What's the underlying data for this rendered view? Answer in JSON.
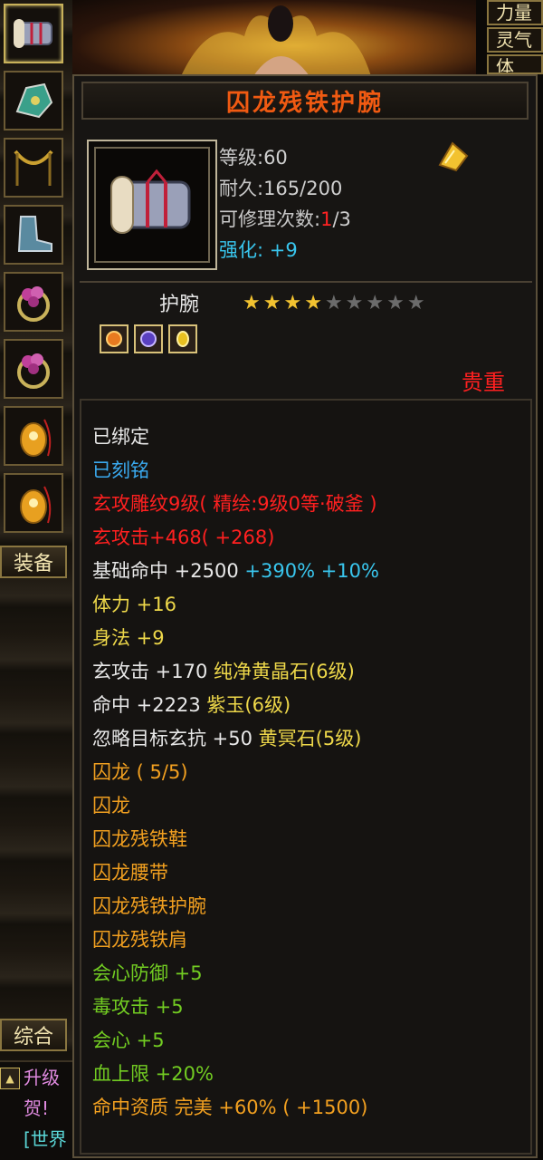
{
  "left_panel": {
    "tab_equipment": "装备",
    "tab_general": "综合",
    "chat_lines": [
      "升级",
      "贺!",
      "[世界"
    ],
    "chat_colors": [
      "#e08ae0",
      "#e08ae0",
      "#5ad6d6"
    ],
    "slots": [
      "bracer",
      "gauntlet",
      "necklace",
      "boots",
      "ring",
      "ring",
      "pendant",
      "pendant"
    ]
  },
  "right_buttons": [
    "力量",
    "灵气",
    "体"
  ],
  "tooltip": {
    "title": "囚龙残铁护腕",
    "level_label": "等级",
    "level_value": ":60",
    "durability_label": "耐久",
    "durability_value": ":165/200",
    "repair_label": "可修理次数",
    "repair_used": "1",
    "repair_total": "/3",
    "enhance_label": "强化",
    "enhance_value": ": +9",
    "item_type": "护腕",
    "stars": {
      "filled": 4,
      "total": 9
    },
    "quality": "贵重",
    "colors": {
      "title": "#f05a12",
      "cyan": "#39c6ee",
      "red": "#ff2020"
    }
  },
  "attributes": [
    {
      "text": "已绑定",
      "color": "white"
    },
    {
      "text": "已刻铭",
      "color": "blue"
    },
    {
      "text": "玄攻雕纹9级( 精绘:9级0等·破釜 )",
      "color": "red"
    },
    {
      "text": "玄攻击+468( +268)",
      "color": "red"
    },
    {
      "text": "基础命中 +2500 ",
      "color": "white",
      "extra": "+390% +10%",
      "extra_color": "cyan"
    },
    {
      "text": "体力 +16",
      "color": "yellow"
    },
    {
      "text": "身法 +9",
      "color": "yellow"
    },
    {
      "text": "玄攻击 +170 ",
      "color": "white",
      "extra": "纯净黄晶石(6级)",
      "extra_color": "yellow"
    },
    {
      "text": "命中 +2223 ",
      "color": "white",
      "extra": "紫玉(6级)",
      "extra_color": "yellow"
    },
    {
      "text": "忽略目标玄抗 +50 ",
      "color": "white",
      "extra": "黄冥石(5级)",
      "extra_color": "yellow"
    },
    {
      "text": "囚龙 ( 5/5)",
      "color": "orange"
    },
    {
      "text": "囚龙",
      "color": "orange"
    },
    {
      "text": "囚龙残铁鞋",
      "color": "orange"
    },
    {
      "text": "囚龙腰带",
      "color": "orange"
    },
    {
      "text": "囚龙残铁护腕",
      "color": "orange"
    },
    {
      "text": "囚龙残铁肩",
      "color": "orange"
    },
    {
      "text": "会心防御 +5",
      "color": "green"
    },
    {
      "text": "毒攻击 +5",
      "color": "green"
    },
    {
      "text": "会心 +5",
      "color": "green"
    },
    {
      "text": "血上限 +20%",
      "color": "green"
    },
    {
      "text": "命中资质  完美 +60% ( +1500)",
      "color": "orange"
    }
  ]
}
